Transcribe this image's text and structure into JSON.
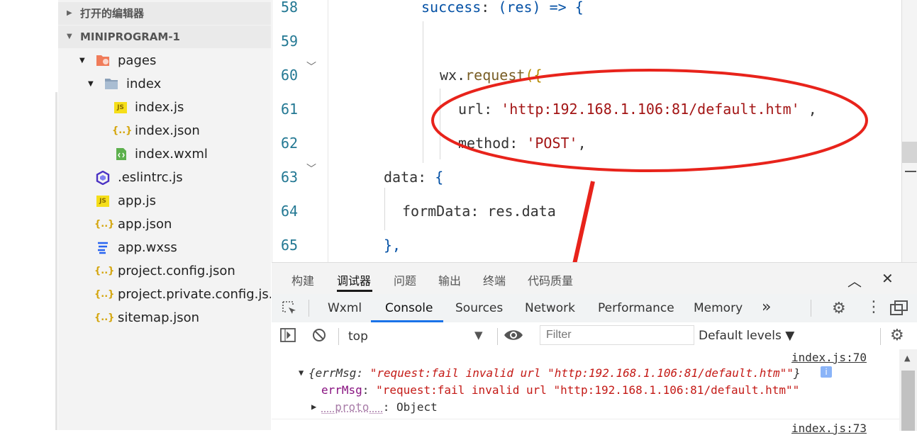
{
  "explorer": {
    "open_editors_label": "打开的编辑器",
    "project_label": "MINIPROGRAM-1",
    "items": [
      {
        "label": "pages",
        "icon": "pages-folder-icon"
      },
      {
        "label": "index",
        "icon": "folder-icon"
      },
      {
        "label": "index.js",
        "icon": "js-file-icon",
        "glyph": "JS"
      },
      {
        "label": "index.json",
        "icon": "json-file-icon",
        "glyph": "{..}"
      },
      {
        "label": "index.wxml",
        "icon": "wxml-file-icon"
      },
      {
        "label": ".eslintrc.js",
        "icon": "eslint-icon"
      },
      {
        "label": "app.js",
        "icon": "js-file-icon",
        "glyph": "JS"
      },
      {
        "label": "app.json",
        "icon": "json-file-icon",
        "glyph": "{..}"
      },
      {
        "label": "app.wxss",
        "icon": "css-file-icon"
      },
      {
        "label": "project.config.json",
        "icon": "json-file-icon",
        "glyph": "{..}"
      },
      {
        "label": "project.private.config.js...",
        "icon": "json-file-icon",
        "glyph": "{..}"
      },
      {
        "label": "sitemap.json",
        "icon": "json-file-icon",
        "glyph": "{..}"
      }
    ]
  },
  "editor": {
    "lines": [
      {
        "num": "58",
        "a": "success",
        "b": ": ",
        "c": "(res) => {"
      },
      {
        "num": "59"
      },
      {
        "num": "60",
        "a": "wx",
        "b": ".",
        "c": "request",
        "d": "({"
      },
      {
        "num": "61",
        "a": "url",
        "b": ": ",
        "c": "'http:192.168.1.106:81/default.htm'",
        "d": " ,"
      },
      {
        "num": "62",
        "a": "method",
        "b": ": ",
        "c": "'POST'",
        "d": ","
      },
      {
        "num": "63",
        "a": "data",
        "b": ": ",
        "c": "{"
      },
      {
        "num": "64",
        "a": "formData",
        "b": ": ",
        "c": "res.data"
      },
      {
        "num": "65",
        "a": "},"
      }
    ]
  },
  "devtools": {
    "panel_tabs": [
      "构建",
      "调试器",
      "问题",
      "输出",
      "终端",
      "代码质量"
    ],
    "active_panel_tab": "调试器",
    "chrome_tabs": [
      "Wxml",
      "Console",
      "Sources",
      "Network",
      "Performance",
      "Memory"
    ],
    "active_chrome_tab": "Console",
    "more_tabs": "»",
    "context": "top",
    "filter_placeholder": "Filter",
    "levels": "Default levels ▼",
    "logs": [
      {
        "source": "index.js:70",
        "summary_key": "{errMsg",
        "summary_value": "\"request:fail invalid url \"http:192.168.1.106:81/default.htm\"\"",
        "summary_close": "}",
        "prop_key": "errMsg",
        "prop_value": "\"request:fail invalid url \"http:192.168.1.106:81/default.htm\"\"",
        "proto_key": "__proto__",
        "proto_value": ": Object"
      },
      {
        "source": "index.js:73"
      }
    ]
  },
  "colors": {
    "annotation_red": "#e8231b",
    "string": "#a31515",
    "keyword": "#0451a5",
    "accent_blue": "#1a73e8"
  }
}
